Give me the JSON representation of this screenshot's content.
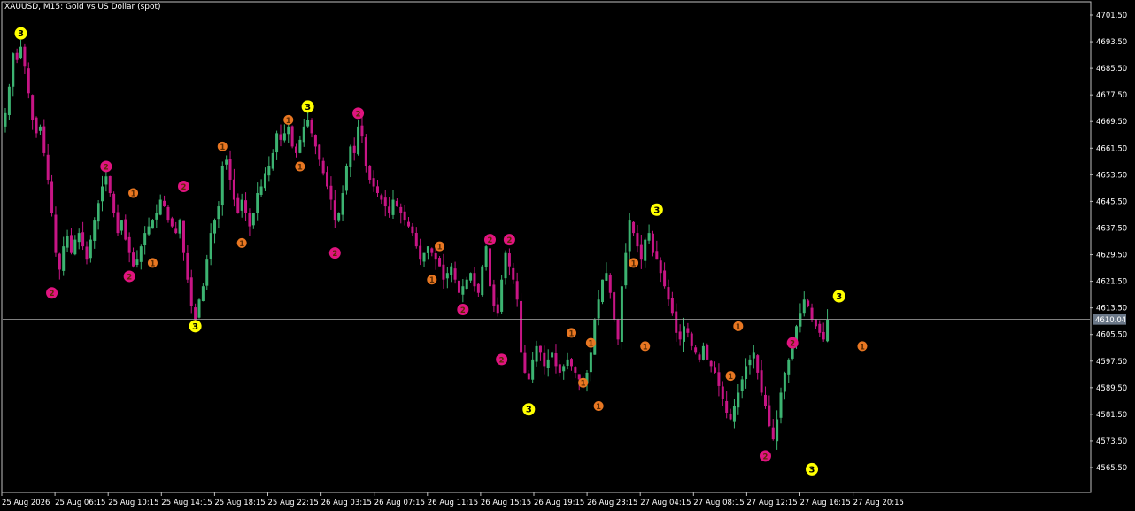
{
  "window": {
    "title": "XAUUSD, M15:  Gold vs US Dollar (spot)"
  },
  "colors": {
    "background": "#000000",
    "frame": "#c0c0c0",
    "bull": "#3cb371",
    "bear": "#c71585",
    "level3_marker": "#ffff00",
    "level2_marker": "#e0147f",
    "level1_marker": "#e87722",
    "price_line": "#a9a9a9",
    "price_tag_bg": "#6b7888"
  },
  "chart_data": {
    "type": "candlestick",
    "symbol": "XAUUSD",
    "timeframe": "M15",
    "ylim": [
      4561.0,
      4705.5
    ],
    "y_ticks": [
      "4701.50",
      "4693.50",
      "4685.50",
      "4677.50",
      "4669.50",
      "4661.50",
      "4653.50",
      "4645.50",
      "4637.50",
      "4629.50",
      "4621.50",
      "4613.50",
      "4605.50",
      "4597.50",
      "4589.50",
      "4581.50",
      "4573.50",
      "4565.50"
    ],
    "x_ticks": [
      "25 Aug 2026",
      "25 Aug 06:15",
      "25 Aug 10:15",
      "25 Aug 14:15",
      "25 Aug 18:15",
      "25 Aug 22:15",
      "26 Aug 03:15",
      "26 Aug 07:15",
      "26 Aug 11:15",
      "26 Aug 15:15",
      "26 Aug 19:15",
      "26 Aug 23:15",
      "27 Aug 04:15",
      "27 Aug 08:15",
      "27 Aug 12:15",
      "27 Aug 16:15",
      "27 Aug 20:15"
    ],
    "current_price": "4610.04",
    "closes": [
      4672,
      4680,
      4690,
      4688,
      4692,
      4686,
      4678,
      4670,
      4666,
      4668,
      4660,
      4652,
      4642,
      4630,
      4625,
      4632,
      4635,
      4630,
      4634,
      4636,
      4632,
      4628,
      4634,
      4640,
      4645,
      4650,
      4653,
      4648,
      4642,
      4636,
      4640,
      4634,
      4630,
      4626,
      4628,
      4632,
      4636,
      4638,
      4640,
      4642,
      4646,
      4644,
      4640,
      4638,
      4636,
      4640,
      4630,
      4622,
      4614,
      4610,
      4616,
      4620,
      4628,
      4636,
      4640,
      4644,
      4656,
      4658,
      4652,
      4646,
      4642,
      4646,
      4642,
      4638,
      4642,
      4648,
      4650,
      4654,
      4656,
      4660,
      4666,
      4664,
      4666,
      4668,
      4662,
      4660,
      4664,
      4668,
      4670,
      4666,
      4662,
      4658,
      4654,
      4650,
      4646,
      4640,
      4642,
      4648,
      4656,
      4662,
      4660,
      4668,
      4665,
      4656,
      4652,
      4650,
      4648,
      4646,
      4644,
      4642,
      4646,
      4644,
      4642,
      4640,
      4638,
      4636,
      4632,
      4628,
      4630,
      4632,
      4630,
      4628,
      4626,
      4622,
      4624,
      4626,
      4622,
      4618,
      4620,
      4622,
      4624,
      4620,
      4618,
      4626,
      4632,
      4620,
      4614,
      4612,
      4622,
      4630,
      4626,
      4622,
      4616,
      4600,
      4594,
      4592,
      4598,
      4602,
      4600,
      4596,
      4598,
      4600,
      4596,
      4594,
      4596,
      4598,
      4596,
      4594,
      4592,
      4590,
      4594,
      4600,
      4610,
      4616,
      4622,
      4624,
      4618,
      4610,
      4604,
      4620,
      4630,
      4640,
      4636,
      4632,
      4628,
      4634,
      4636,
      4630,
      4628,
      4624,
      4620,
      4616,
      4612,
      4606,
      4604,
      4608,
      4606,
      4602,
      4600,
      4598,
      4602,
      4598,
      4596,
      4594,
      4590,
      4586,
      4582,
      4580,
      4584,
      4588,
      4592,
      4596,
      4598,
      4600,
      4594,
      4588,
      4584,
      4578,
      4574,
      4580,
      4588,
      4594,
      4598,
      4602,
      4608,
      4612,
      4616,
      4614,
      4610,
      4608,
      4606,
      4604,
      4610
    ],
    "markers": [
      {
        "i": 4,
        "side": "top",
        "level": 3,
        "price": 4696
      },
      {
        "i": 12,
        "side": "bottom",
        "level": 2,
        "price": 4618
      },
      {
        "i": 26,
        "side": "top",
        "level": 2,
        "price": 4656
      },
      {
        "i": 32,
        "side": "bottom",
        "level": 2,
        "price": 4623
      },
      {
        "i": 33,
        "side": "top",
        "level": 1,
        "price": 4648
      },
      {
        "i": 38,
        "side": "bottom",
        "level": 1,
        "price": 4627
      },
      {
        "i": 46,
        "side": "top",
        "level": 2,
        "price": 4650
      },
      {
        "i": 49,
        "side": "bottom",
        "level": 3,
        "price": 4608
      },
      {
        "i": 56,
        "side": "top",
        "level": 1,
        "price": 4662
      },
      {
        "i": 61,
        "side": "bottom",
        "level": 1,
        "price": 4633
      },
      {
        "i": 73,
        "side": "top",
        "level": 1,
        "price": 4670
      },
      {
        "i": 76,
        "side": "bottom",
        "level": 1,
        "price": 4656
      },
      {
        "i": 78,
        "side": "top",
        "level": 3,
        "price": 4674
      },
      {
        "i": 85,
        "side": "bottom",
        "level": 2,
        "price": 4630
      },
      {
        "i": 91,
        "side": "top",
        "level": 2,
        "price": 4672
      },
      {
        "i": 112,
        "side": "top",
        "level": 1,
        "price": 4632
      },
      {
        "i": 110,
        "side": "bottom",
        "level": 1,
        "price": 4622
      },
      {
        "i": 118,
        "side": "bottom",
        "level": 2,
        "price": 4613
      },
      {
        "i": 125,
        "side": "top",
        "level": 2,
        "price": 4634
      },
      {
        "i": 128,
        "side": "bottom",
        "level": 2,
        "price": 4598
      },
      {
        "i": 130,
        "side": "top",
        "level": 2,
        "price": 4634
      },
      {
        "i": 135,
        "side": "bottom",
        "level": 3,
        "price": 4583
      },
      {
        "i": 146,
        "side": "top",
        "level": 1,
        "price": 4606
      },
      {
        "i": 149,
        "side": "bottom",
        "level": 1,
        "price": 4591
      },
      {
        "i": 151,
        "side": "top",
        "level": 1,
        "price": 4603
      },
      {
        "i": 153,
        "side": "bottom",
        "level": 1,
        "price": 4584
      },
      {
        "i": 162,
        "side": "top",
        "level": 1,
        "price": 4627
      },
      {
        "i": 165,
        "side": "bottom",
        "level": 1,
        "price": 4602
      },
      {
        "i": 168,
        "side": "top",
        "level": 3,
        "price": 4643
      },
      {
        "i": 189,
        "side": "top",
        "level": 1,
        "price": 4608
      },
      {
        "i": 187,
        "side": "bottom",
        "level": 1,
        "price": 4593
      },
      {
        "i": 196,
        "side": "bottom",
        "level": 2,
        "price": 4569
      },
      {
        "i": 203,
        "side": "top",
        "level": 2,
        "price": 4603
      },
      {
        "i": 208,
        "side": "bottom",
        "level": 3,
        "price": 4565
      },
      {
        "i": 215,
        "side": "top",
        "level": 3,
        "price": 4617
      },
      {
        "i": 221,
        "side": "bottom",
        "level": 1,
        "price": 4602
      }
    ]
  }
}
